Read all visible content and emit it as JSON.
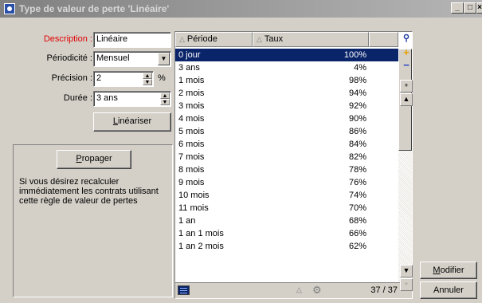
{
  "window": {
    "title": "Type de valeur de perte 'Linéaire'",
    "controls": [
      "_",
      "□",
      "×"
    ]
  },
  "form": {
    "description_label": "Description :",
    "description_value": "Linéaire",
    "periodicite_label": "Périodicité :",
    "periodicite_value": "Mensuel",
    "precision_label": "Précision :",
    "precision_value": "2",
    "precision_unit": "%",
    "duree_label": "Durée :",
    "duree_value": "3 ans",
    "linearise_button": "Linéariser"
  },
  "propagate": {
    "button": "Propager",
    "description": "Si vous désirez recalculer immédiatement les contrats utilisant cette règle de valeur de pertes"
  },
  "table": {
    "columns": [
      "Période",
      "Taux"
    ],
    "rows": [
      {
        "periode": "0 jour",
        "taux": "100%"
      },
      {
        "periode": "3 ans",
        "taux": "4%"
      },
      {
        "periode": "1 mois",
        "taux": "98%"
      },
      {
        "periode": "2 mois",
        "taux": "94%"
      },
      {
        "periode": "3 mois",
        "taux": "92%"
      },
      {
        "periode": "4 mois",
        "taux": "90%"
      },
      {
        "periode": "5 mois",
        "taux": "86%"
      },
      {
        "periode": "6 mois",
        "taux": "84%"
      },
      {
        "periode": "7 mois",
        "taux": "82%"
      },
      {
        "periode": "8 mois",
        "taux": "78%"
      },
      {
        "periode": "9 mois",
        "taux": "76%"
      },
      {
        "periode": "10 mois",
        "taux": "74%"
      },
      {
        "periode": "11 mois",
        "taux": "70%"
      },
      {
        "periode": "1 an",
        "taux": "68%"
      },
      {
        "periode": "1 an 1 mois",
        "taux": "66%"
      },
      {
        "periode": "1 an 2 mois",
        "taux": "62%"
      }
    ],
    "selected_row": 0,
    "record_count": "37 / 37"
  },
  "actions": {
    "modify": "Modifier",
    "cancel": "Annuler"
  },
  "colors": {
    "selection": "#0a246a",
    "required_label": "#e00000",
    "add_icon": "#e8a000",
    "remove_icon": "#2040c0"
  },
  "icons": [
    "app-icon",
    "search-icon",
    "add-icon",
    "remove-icon",
    "expand-icon",
    "sort-icon",
    "scroll-up-icon",
    "scroll-down-icon",
    "grid-icon",
    "settings-icon"
  ]
}
